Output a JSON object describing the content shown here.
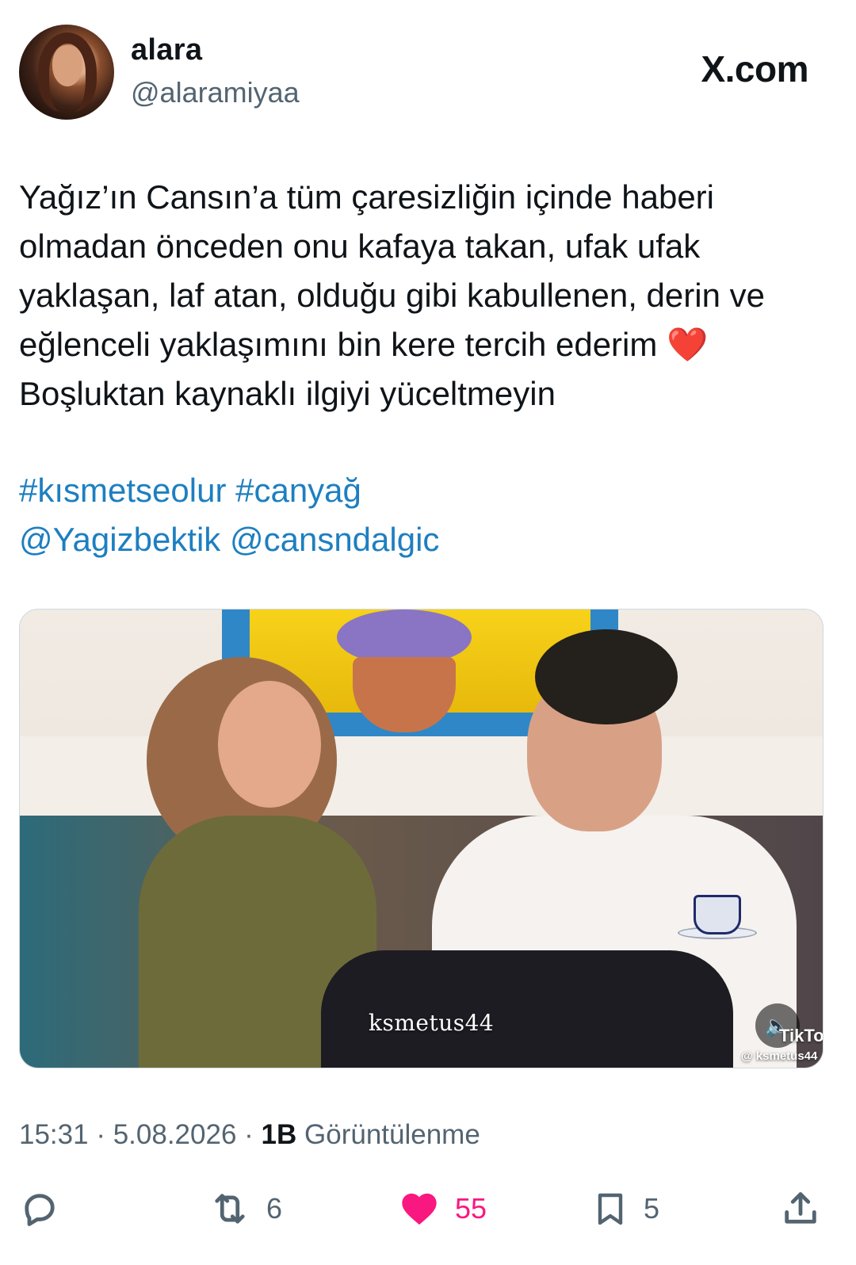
{
  "author": {
    "display_name": "alara",
    "handle": "@alaramiyaa"
  },
  "brand": "X.com",
  "tweet": {
    "text": "Yağız’ın Cansın’a tüm çaresizliğin içinde haberi olmadan önceden onu kafaya takan, ufak ufak yaklaşan, laf atan, olduğu gibi kabullenen, derin ve eğlenceli yaklaşımını bin kere tercih ederim ",
    "emoji": "❤️",
    "text_line2": "Boşluktan kaynaklı ilgiyi yüceltmeyin",
    "hashtags": [
      "#kısmetseolur",
      "#canyağ"
    ],
    "mentions": [
      "@Yagizbektik",
      "@cansndalgic"
    ]
  },
  "media": {
    "watermark_center": "ksmetus44",
    "watermark_brand": "TikTok",
    "watermark_handle": "@ ksmetus44"
  },
  "meta": {
    "time": "15:31",
    "date": "5.08.2026",
    "views_count": "1B",
    "views_label": "Görüntülenme"
  },
  "actions": {
    "reply_count": "",
    "retweet_count": "6",
    "like_count": "55",
    "bookmark_count": "5"
  },
  "colors": {
    "link": "#1d7fc0",
    "like": "#f91880",
    "muted": "#536471"
  },
  "icons": [
    "reply-icon",
    "retweet-icon",
    "like-icon",
    "bookmark-icon",
    "share-icon",
    "mute-icon"
  ]
}
